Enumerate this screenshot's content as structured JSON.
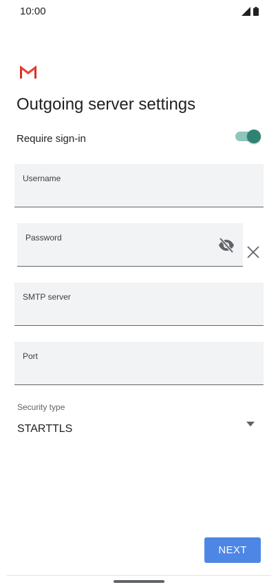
{
  "status_bar": {
    "time": "10:00",
    "icons": [
      "signal-icon",
      "battery-icon"
    ]
  },
  "app": {
    "logo": "gmail-logo"
  },
  "header": {
    "title": "Outgoing server settings"
  },
  "require_signin": {
    "label": "Require sign-in",
    "enabled": true
  },
  "fields": {
    "username": {
      "label": "Username",
      "value": ""
    },
    "password": {
      "label": "Password",
      "value": ""
    },
    "smtp_server": {
      "label": "SMTP server",
      "value": ""
    },
    "port": {
      "label": "Port",
      "value": ""
    }
  },
  "security": {
    "label": "Security type",
    "value": "STARTTLS"
  },
  "actions": {
    "next_label": "NEXT"
  },
  "colors": {
    "accent_button": "#4e86e6",
    "toggle_on": "#2f8372",
    "field_bg": "#f1f3f4"
  }
}
